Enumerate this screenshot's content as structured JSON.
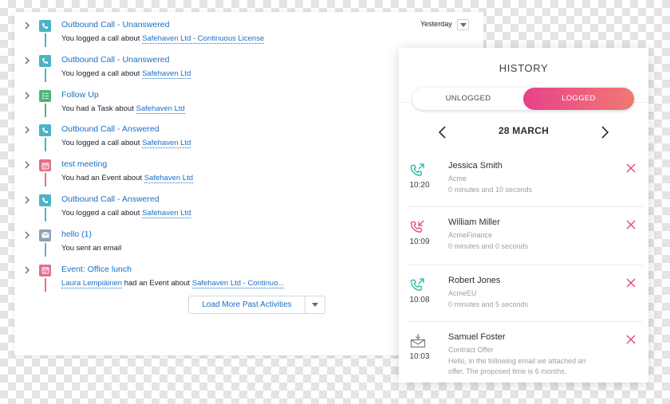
{
  "colors": {
    "link": "#1a6fc4",
    "call": "#4cb3c6",
    "task": "#4fb37a",
    "event": "#e2708a",
    "email": "#8e9fb6",
    "accent_pink": "#e8418a",
    "accent_teal": "#23b6a4"
  },
  "timeline": {
    "date_filter": "Yesterday",
    "activities": [
      {
        "icon": "phone-icon",
        "type": "call",
        "title": "Outbound Call - Unanswered",
        "prefix": "You logged a call about",
        "link": "Safehaven Ltd - Continuous License"
      },
      {
        "icon": "phone-icon",
        "type": "call",
        "title": "Outbound Call - Unanswered",
        "prefix": "You logged a call about",
        "link": "Safehaven Ltd"
      },
      {
        "icon": "task-list-icon",
        "type": "task",
        "title": "Follow Up",
        "prefix": "You had a Task about",
        "link": "Safehaven Ltd"
      },
      {
        "icon": "phone-icon",
        "type": "call",
        "title": "Outbound Call - Answered",
        "prefix": "You logged a call about",
        "link": "Safehaven Ltd"
      },
      {
        "icon": "calendar-icon",
        "type": "event",
        "title": "test meeting",
        "prefix": "You had an Event about",
        "link": "Safehaven Ltd"
      },
      {
        "icon": "phone-icon",
        "type": "call",
        "title": "Outbound Call - Answered",
        "prefix": "You logged a call about",
        "link": "Safehaven Ltd"
      },
      {
        "icon": "email-icon",
        "type": "email",
        "title": "hello (1)",
        "prefix": "You sent an email",
        "link": ""
      },
      {
        "icon": "calendar-icon",
        "type": "event",
        "title": "Event: Office lunch",
        "person": "Laura Lempiäinen",
        "prefix": "had an Event about",
        "link": "Safehaven Ltd - Continuo..."
      }
    ],
    "load_more_label": "Load More Past Activities"
  },
  "history": {
    "title": "HISTORY",
    "tabs": {
      "unlogged": "UNLOGGED",
      "logged": "LOGGED",
      "active": "logged"
    },
    "date": "28 MARCH",
    "entries": [
      {
        "icon": "outgoing-call-icon",
        "time": "10:20",
        "name": "Jessica Smith",
        "company": "Acme",
        "detail": [
          "0 minutes and 10 seconds"
        ]
      },
      {
        "icon": "incoming-call-icon",
        "time": "10:09",
        "name": "William Miller",
        "company": "AcmeFinance",
        "detail": [
          "0 minutes and 0 seconds"
        ]
      },
      {
        "icon": "outgoing-call-icon",
        "time": "10:08",
        "name": "Robert Jones",
        "company": "AcmeEU",
        "detail": [
          "0 minutes and 5 seconds"
        ]
      },
      {
        "icon": "email-inbox-icon",
        "time": "10:03",
        "name": "Samuel Foster",
        "company": "Contract Offer",
        "detail": [
          "Hello, in the following email we attached an",
          "offer. The proposed time is 6 months."
        ]
      }
    ]
  }
}
